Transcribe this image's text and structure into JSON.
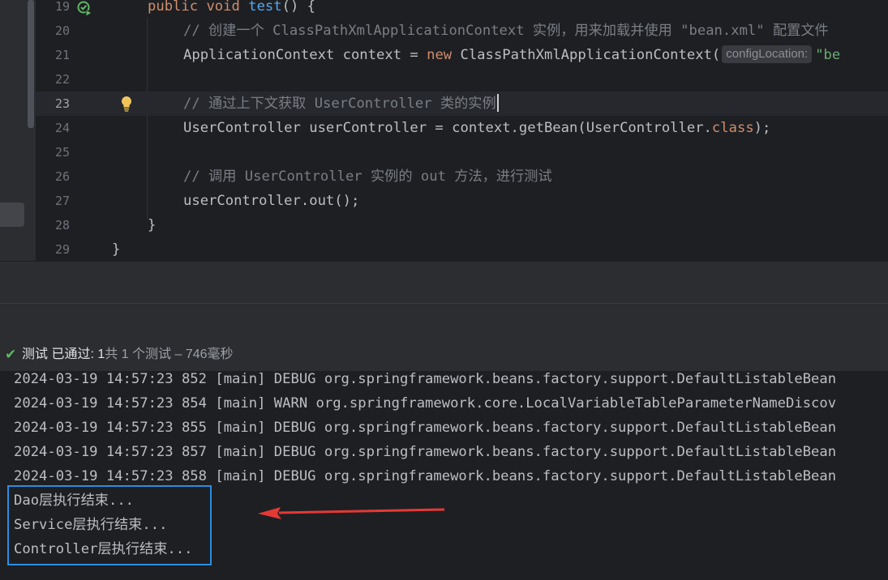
{
  "editor": {
    "lines": [
      {
        "num": "19",
        "code": "    public void test() {"
      },
      {
        "num": "20",
        "comment": "// 创建一个 ClassPathXmlApplicationContext 实例，用来加载并使用 \"bean.xml\" 配置文件"
      },
      {
        "num": "21",
        "type": "ApplicationContext",
        "var": " context = ",
        "kw_new": "new",
        "ctor": " ClassPathXmlApplicationContext(",
        "hint": "configLocation:",
        "str": "\"be"
      },
      {
        "num": "22"
      },
      {
        "num": "23",
        "comment": "// 通过上下文获取 UserController 类的实例"
      },
      {
        "num": "24",
        "code_a": "UserController userController = context.getBean(UserController.",
        "kw_class": "class",
        "code_b": ");"
      },
      {
        "num": "25"
      },
      {
        "num": "26",
        "comment": "// 调用 UserController 实例的 out 方法，进行测试"
      },
      {
        "num": "27",
        "code": "userController.out();"
      },
      {
        "num": "28",
        "code": "}"
      },
      {
        "num": "29",
        "code": "}"
      }
    ],
    "line19": {
      "kw_public": "public",
      "kw_void": "void",
      "fn": "test",
      "rest": "() {"
    },
    "current_line": "23",
    "icons": {
      "run": "run-test-icon",
      "bulb": "lightbulb-icon"
    }
  },
  "status": {
    "icon": "check-icon",
    "label": "测试 已通过: ",
    "passed": "1",
    "summary": "共 1 个测试 – 746毫秒"
  },
  "console": {
    "lines": [
      "2024-03-19 14:57:23 852 [main] DEBUG org.springframework.beans.factory.support.DefaultListableBean",
      "2024-03-19 14:57:23 854 [main] WARN org.springframework.core.LocalVariableTableParameterNameDiscov",
      "2024-03-19 14:57:23 855 [main] DEBUG org.springframework.beans.factory.support.DefaultListableBean",
      "2024-03-19 14:57:23 857 [main] DEBUG org.springframework.beans.factory.support.DefaultListableBean",
      "2024-03-19 14:57:23 858 [main] DEBUG org.springframework.beans.factory.support.DefaultListableBean",
      "Dao层执行结束...",
      "Service层执行结束...",
      "Controller层执行结束..."
    ],
    "annotation": {
      "box_color": "#2d8de0",
      "arrow_color": "#e53935"
    }
  }
}
